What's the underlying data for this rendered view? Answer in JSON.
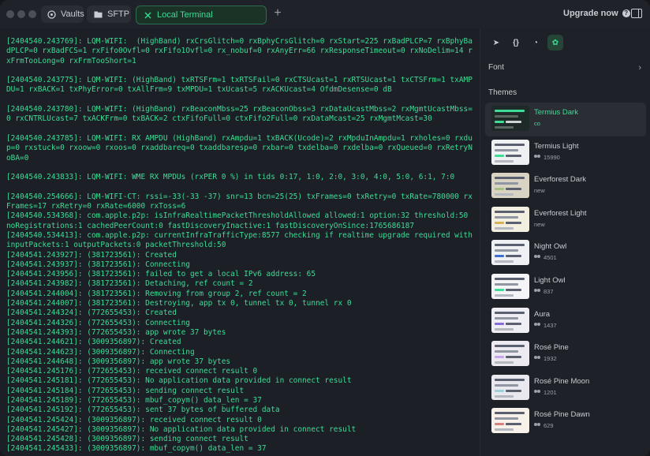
{
  "tabs": [
    {
      "label": "Vaults",
      "icon": "vault-icon"
    },
    {
      "label": "SFTP",
      "icon": "folder-icon"
    },
    {
      "label": "Local Terminal",
      "icon": "terminal-icon"
    }
  ],
  "header": {
    "upgrade_label": "Upgrade now"
  },
  "terminal": {
    "lines": [
      "[2404540.243769]: LQM-WIFI:  (HighBand) rxCrsGlitch=0 rxBphyCrsGlitch=0 rxStart=225 rxBadPLCP=7 rxBphyBadPLCP=0 rxBadFCS=1 rxFifo0Ovfl=0 rxFifo1Ovfl=0 rx_nobuf=0 rxAnyErr=66 rxResponseTimeout=0 rxNoDelim=14 rxFrmTooLong=0 rxFrmTooShort=1",
      "",
      "[2404540.243775]: LQM-WIFI: (HighBand) txRTSFrm=1 txRTSFail=0 rxCTSUcast=1 rxRTSUcast=1 txCTSFrm=1 txAMPDU=1 rxBACK=1 txPhyError=0 txAllFrm=9 txMPDU=1 txUcast=5 rxACKUcast=4 OfdmDesense=0 dB",
      "",
      "[2404540.243780]: LQM-WIFI: (HighBand) rxBeaconMbss=25 rxBeaconObss=3 rxDataUcastMbss=2 rxMgmtUcastMbss=0 rxCNTRLUcast=7 txACKFrm=0 txBACK=2 ctxFifoFull=0 ctxFifo2Full=0 rxDataMcast=25 rxMgmtMcast=30",
      "",
      "[2404540.243785]: LQM-WIFI: RX AMPDU (HighBand) rxAmpdu=1 txBACK(Ucode)=2 rxMpduInAmpdu=1 rxholes=0 rxdup=0 rxstuck=0 rxoow=0 rxoos=0 rxaddbareq=0 txaddbaresp=0 rxbar=0 txdelba=0 rxdelba=0 rxQueued=0 rxRetryNoBA=0",
      "",
      "[2404540.243833]: LQM-WIFI: WME RX MPDUs (rxPER 0 %) in tids 0:17, 1:0, 2:0, 3:0, 4:0, 5:0, 6:1, 7:0",
      "",
      "[2404540.254666]: LQM-WIFI-CT: rssi=-33(-33 -37) snr=13 bcn=25(25) txFrames=0 txRetry=0 txRate=780000 rxFrames=17 rxRetry=0 rxRate=6000 rxToss=6",
      "[2404540.534368]: com.apple.p2p: isInfraRealtimePacketThresholdAllowed allowed:1 option:32 threshold:50 noRegistrations:1 cachedPeerCount:0 fastDiscoveryInactive:1 fastDiscoveryOnSince:1765686187",
      "[2404540.534413]: com.apple.p2p: currentInfraTrafficType:8577 checking if realtime upgrade required with inputPackets:1 outputPackets:0 packetThreshold:50",
      "[2404541.243927]: (381723561): Created",
      "[2404541.243937]: (381723561): Connecting",
      "[2404541.243956]: (381723561): failed to get a local IPv6 address: 65",
      "[2404541.243982]: (381723561): Detaching, ref count = 2",
      "[2404541.244004]: (381723561): Removing from group 2, ref count = 2",
      "[2404541.244007]: (381723561): Destroying, app tx 0, tunnel tx 0, tunnel rx 0",
      "[2404541.244324]: (772655453): Created",
      "[2404541.244326]: (772655453): Connecting",
      "[2404541.244393]: (772655453): app wrote 37 bytes",
      "[2404541.244621]: (3009356897): Created",
      "[2404541.244623]: (3009356897): Connecting",
      "[2404541.244648]: (3009356897): app wrote 37 bytes",
      "[2404541.245176]: (772655453): received connect result 0",
      "[2404541.245181]: (772655453): No application data provided in connect result",
      "[2404541.245184]: (772655453): sending connect result",
      "[2404541.245189]: (772655453): mbuf_copym() data_len = 37",
      "[2404541.245192]: (772655453): sent 37 bytes of buffered data",
      "[2404541.245424]: (3009356897): received connect result 0",
      "[2404541.245427]: (3009356897): No application data provided in connect result",
      "[2404541.245428]: (3009356897): sending connect result",
      "[2404541.245433]: (3009356897): mbuf_copym() data_len = 37"
    ]
  },
  "panel": {
    "tools": [
      "send-icon",
      "snippets-icon",
      "history-icon",
      "palette-icon"
    ],
    "tool_labels": [
      "➤",
      "{}",
      "◔",
      "✿"
    ],
    "font_label": "Font",
    "themes_label": "Themes",
    "themes": [
      {
        "name": "Termius Dark",
        "sub": "co",
        "users": false,
        "bg": "#1e2a27",
        "accent": "#3ddc97",
        "selected": true
      },
      {
        "name": "Termius Light",
        "sub": "15990",
        "users": true,
        "bg": "#eef0f2",
        "accent": "#3ddc97",
        "selected": false
      },
      {
        "name": "Everforest Dark",
        "sub": "new",
        "users": false,
        "bg": "#d8d3c2",
        "accent": "#a7c080",
        "selected": false
      },
      {
        "name": "Everforest Light",
        "sub": "new",
        "users": false,
        "bg": "#f3efe0",
        "accent": "#d6b35a",
        "selected": false
      },
      {
        "name": "Night Owl",
        "sub": "4501",
        "users": true,
        "bg": "#eef0f4",
        "accent": "#3c6fd0",
        "selected": false
      },
      {
        "name": "Light Owl",
        "sub": "837",
        "users": true,
        "bg": "#f4f4f6",
        "accent": "#3ddc97",
        "selected": false
      },
      {
        "name": "Aura",
        "sub": "1437",
        "users": true,
        "bg": "#efeef5",
        "accent": "#8a6cd8",
        "selected": false
      },
      {
        "name": "Rosé Pine",
        "sub": "1932",
        "users": true,
        "bg": "#eceaf0",
        "accent": "#c4a7e7",
        "selected": false
      },
      {
        "name": "Rosé Pine Moon",
        "sub": "1201",
        "users": true,
        "bg": "#eae8ef",
        "accent": "#9ccfd8",
        "selected": false
      },
      {
        "name": "Rosé Pine Dawn",
        "sub": "629",
        "users": true,
        "bg": "#f7f1ea",
        "accent": "#d7827e",
        "selected": false
      }
    ]
  }
}
